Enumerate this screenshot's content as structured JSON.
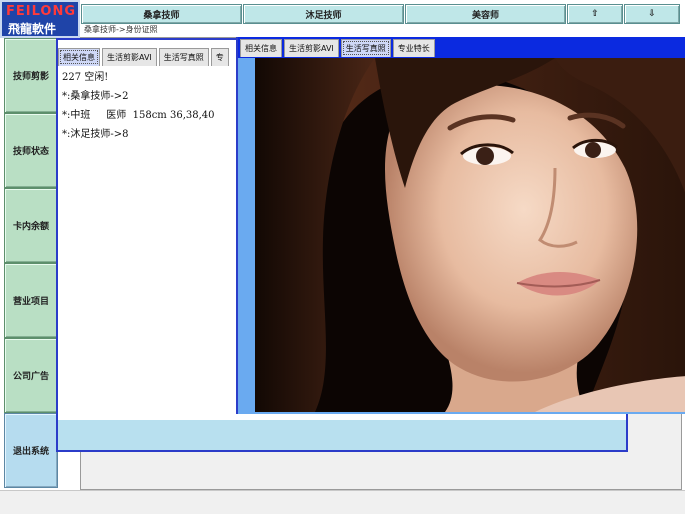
{
  "logo": {
    "brand": "FEILONG",
    "name": "飛龍軟件"
  },
  "top_nav": {
    "items": [
      {
        "label": "桑拿技师"
      },
      {
        "label": "沐足技师"
      },
      {
        "label": "美容师"
      }
    ],
    "up_label": "⇧",
    "down_label": "⇩"
  },
  "breadcrumb": "桑拿技师->身份证照",
  "sidebar": {
    "items": [
      "技师剪影",
      "技师状态",
      "卡内余额",
      "营业项目",
      "公司广告",
      "退出系统"
    ]
  },
  "back_window": {
    "tabs": [
      "相关信息",
      "生活剪影AVI",
      "生活写真照",
      "专"
    ],
    "active_tab": 0,
    "info_lines": [
      "227 空闲!",
      "*:桑拿技师->2",
      "*:中班     医师  158cm 36,38,40",
      "*:沐足技师->8"
    ]
  },
  "front_window": {
    "tabs": [
      "相关信息",
      "生活剪影AVI",
      "生活写真照",
      "专业特长"
    ],
    "active_tab": 2,
    "photo_alt": "portrait-photo"
  },
  "colors": {
    "nav_bg": "#bfe7e8",
    "sidebar_bg": "#b9dfc4",
    "window_border": "#2b3cc9",
    "titlebar": "#0b2ae0"
  }
}
